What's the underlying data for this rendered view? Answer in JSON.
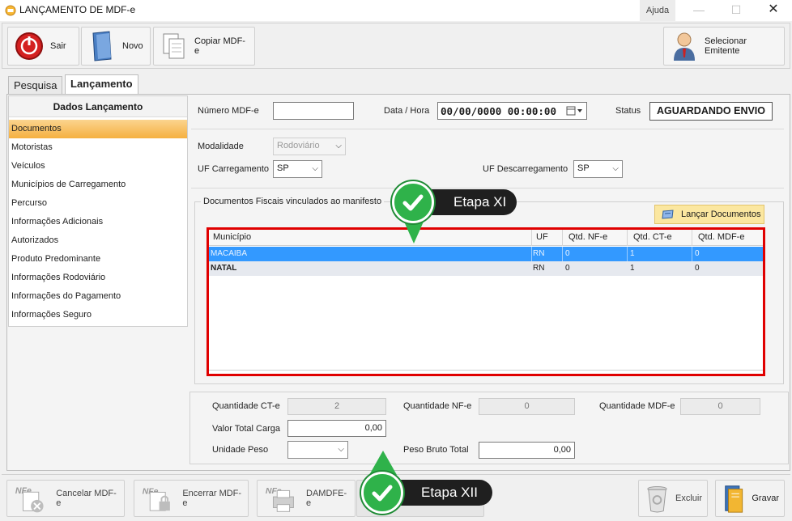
{
  "window": {
    "title": "LANÇAMENTO DE MDF-e",
    "help": "Ajuda",
    "minimize": "—",
    "maximize": "☐",
    "close": "✕"
  },
  "toolbar": {
    "exit_label": "Sair",
    "new_label": "Novo",
    "copy_label": "Copiar MDF-e",
    "select_issuer_label": "Selecionar Emitente"
  },
  "tabs": [
    {
      "label": "Pesquisa",
      "active": false
    },
    {
      "label": "Lançamento",
      "active": true
    }
  ],
  "sidebar": {
    "heading": "Dados Lançamento",
    "items": [
      {
        "label": "Documentos",
        "active": true
      },
      {
        "label": "Motoristas"
      },
      {
        "label": "Veículos"
      },
      {
        "label": "Municípios de Carregamento"
      },
      {
        "label": "Percurso"
      },
      {
        "label": "Informações Adicionais"
      },
      {
        "label": "Autorizados"
      },
      {
        "label": "Produto Predominante"
      },
      {
        "label": "Informações Rodoviário"
      },
      {
        "label": "Informações do Pagamento"
      },
      {
        "label": "Informações Seguro"
      }
    ]
  },
  "form": {
    "mdfe_number_label": "Número MDF-e",
    "mdfe_number_value": "",
    "datetime_label": "Data / Hora",
    "datetime_value": "00/00/0000 00:00:00",
    "status_label": "Status",
    "status_value": "AGUARDANDO ENVIO",
    "modality_label": "Modalidade",
    "modality_value": "Rodoviário",
    "uf_loading_label": "UF Carregamento",
    "uf_loading_value": "SP",
    "uf_unloading_label": "UF Descarregamento",
    "uf_unloading_value": "SP"
  },
  "documents_group": {
    "title": "Documentos Fiscais vinculados ao manifesto",
    "launch_button": "Lançar Documentos",
    "columns": [
      "Município",
      "UF",
      "Qtd. NF-e",
      "Qtd. CT-e",
      "Qtd. MDF-e"
    ],
    "rows": [
      {
        "municipio": "MACAIBA",
        "uf": "RN",
        "nfe": "0",
        "cte": "1",
        "mdfe": "0",
        "selected": true
      },
      {
        "municipio": "NATAL",
        "uf": "RN",
        "nfe": "0",
        "cte": "1",
        "mdfe": "0",
        "selected": false
      }
    ]
  },
  "totals": {
    "qty_cte_label": "Quantidade CT-e",
    "qty_cte_value": "2",
    "qty_nfe_label": "Quantidade NF-e",
    "qty_nfe_value": "0",
    "qty_mdfe_label": "Quantidade MDF-e",
    "qty_mdfe_value": "0",
    "total_value_label": "Valor Total Carga",
    "total_value_value": "0,00",
    "weight_unit_label": "Unidade Peso",
    "weight_unit_value": "",
    "gross_weight_label": "Peso Bruto Total",
    "gross_weight_value": "0,00"
  },
  "callouts": {
    "step_11": "Etapa XI",
    "step_12": "Etapa XII"
  },
  "bottom": {
    "cancel_label": "Cancelar MDF-e",
    "close_label": "Encerrar MDF-e",
    "damdfe_label": "DAMDFE-e",
    "delete_label": "Excluir",
    "save_label": "Gravar"
  },
  "colors": {
    "selected_row": "#3399ff",
    "highlight_border": "#e00000",
    "callout_green": "#2fb24a",
    "active_nav": "#f5b040"
  }
}
